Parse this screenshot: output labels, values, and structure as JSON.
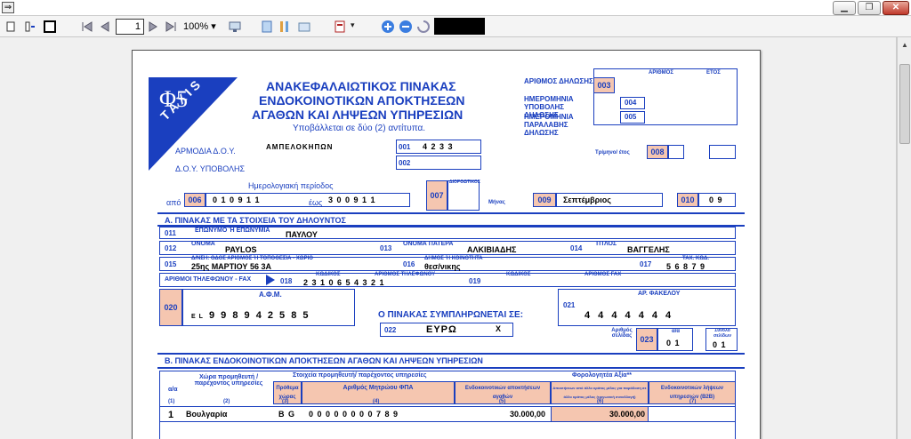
{
  "window": {
    "minimize": "▁",
    "restore": "❐",
    "close": "✕"
  },
  "toolbar": {
    "page": "1",
    "zoom": "100%"
  },
  "colors": {
    "form_blue": "#1a3fbf",
    "code_pink": "#f5c6b0"
  },
  "form": {
    "phi": "Φ5",
    "taxis": "TAXIS",
    "title_1": "ΑΝΑΚΕΦΑΛΑΙΩΤΙΚΟΣ ΠΙΝΑΚΑΣ",
    "title_2": "ΕΝΔΟΚΟΙΝΟΤΙΚΩΝ ΑΠΟΚΤΗΣΕΩΝ",
    "title_3": "ΑΓΑΘΩΝ ΚΑΙ ΛΗΨΕΩΝ ΥΠΗΡΕΣΙΩΝ",
    "subtitle": "Υποβάλλεται σε δύο (2) αντίτυπα.",
    "arithmos_dilosis": "ΑΡΙΘΜΟΣ ΔΗΛΩΣΗΣ",
    "hm_ypovolis": "ΗΜΕΡΟΜΗΝΙΑ ΥΠΟΒΟΛΗΣ ΔΗΛΩΣΗΣ",
    "hm_paralavis": "ΗΜΕΡΟΜΗΝΙΑ ΠΑΡΑΛΑΒΗΣ ΔΗΛΩΣΗΣ",
    "arithmos_col": "ΑΡΙΘΜΟΣ",
    "etos_col": "ΕΤΟΣ",
    "c003": "003",
    "c004": "004",
    "c005": "005",
    "armodia_doy": "ΑΡΜΟΔΙΑ Δ.Ο.Υ.",
    "doy_value": "ΑΜΠΕΛΟΚΗΠΩΝ",
    "doy_ypovolis": "Δ.Ο.Υ. ΥΠΟΒΟΛΗΣ",
    "c001": "001",
    "c001_value": "4 2 3 3",
    "c002": "002",
    "trimino": "Τρίμηνο/ έτος",
    "c008": "008",
    "imerologiaki": "Ημερολογιακή περίοδος",
    "apo": "από",
    "c006": "006",
    "c006_value": "0 1 0 9 1 1",
    "eos": "έως",
    "eos_value": "3 0 0 9 1 1",
    "c007": "007",
    "diorthotiki": "ΔΙΟΡΘΩΤΙΚΟΣ",
    "minas": "Μήνας",
    "c009": "009",
    "c009_value": "Σεπτέμβριος",
    "c010": "010",
    "c010_value": "0 9",
    "section_a": "Α. ΠΙΝΑΚΑΣ ΜΕ ΤΑ ΣΤΟΙΧΕΙΑ ΤΟΥ ΔΗΛΟΥΝΤΟΣ",
    "c011": "011",
    "eponymo_lbl": "ΕΠΩΝΥΜΟ Ή ΕΠΩΝΥΜΙΑ",
    "eponymo": "ΠΑΥΛΟΥ",
    "c012": "012",
    "onoma_lbl": "ΟΝΟΜΑ",
    "onoma": "PAYLOS",
    "c013": "013",
    "onoma_patera_lbl": "ΟΝΟΜΑ ΠΑΤΕΡΑ",
    "onoma_patera": "ΑΛΚΙΒΙΑΔΗΣ",
    "c014": "014",
    "titlos_lbl": "ΤΙΤΛΟΣ",
    "titlos": "ΒΑΓΓΕΛΗΣ",
    "c015": "015",
    "dieuthinsi_lbl": "Δ/ΝΣΗ: ΟΔΟΣ ΑΡΙΘΜΟΣ Ή ΤΟΠΟΘΕΣΙΑ - ΧΩΡΙΟ",
    "dieuthinsi": "25ης ΜΑΡΤΙΟΥ 56 3Α",
    "c016": "016",
    "dimos_lbl": "ΔΗΜΟΣ Ή ΚΟΙΝΟΤΗΤΑ",
    "dimos": "θεσ/νικης",
    "c017": "017",
    "tk_lbl": "ΤΑΧ. ΚΩΔ.",
    "tk": "5 6 8 7 9",
    "tilefono_lbl": "ΑΡΙΘΜΟΙ ΤΗΛΕΦΩΝΟΥ - FAX",
    "c018": "018",
    "kodikos_lbl": "ΚΩΔΙΚΟΣ",
    "ar_til_lbl": "ΑΡΙΘΜΟΣ ΤΗΛΕΦΩΝΟΥ",
    "tilefono": "2 3 1 0 6 5 4 3 2 1",
    "c019": "019",
    "kodikos2_lbl": "ΚΩΔΙΚΟΣ",
    "ar_fax_lbl": "ΑΡΙΘΜΟΣ FAX",
    "c020": "020",
    "afm_lbl": "Α.Φ.Μ.",
    "afm_prefix": "E L",
    "afm": "9 9 8 9 4 2 5 8 5",
    "o_pinakas": "Ο ΠΙΝΑΚΑΣ ΣΥΜΠΛΗΡΩΝΕΤΑΙ ΣΕ:",
    "c022": "022",
    "euro": "ΕΥΡΩ",
    "euro_x": "X",
    "c021": "021",
    "ar_fakelou_lbl": "ΑΡ. ΦΑΚΕΛΟΥ",
    "ar_fakelou": "4 4 4 4 4 4 4",
    "arithmos_selidas": "Αριθμός σελίδας",
    "c023": "023",
    "aa_lbl": "α/α",
    "aa": "0 1",
    "synolo_lbl": "Σύνολο σελίδων",
    "synolo": "0 1",
    "section_b": "Β. ΠΙΝΑΚΑΣ ΕΝΔΟΚΟΙΝΟΤΙΚΩΝ ΑΠΟΚΤΗΣΕΩΝ ΑΓΑΘΩΝ ΚΑΙ ΛΗΨΕΩΝ ΥΠΗΡΕΣΙΩΝ",
    "table": {
      "aa_h": "α/α",
      "aa_n": "(1)",
      "xora_h": "Χώρα προμηθευτή / παρέχοντος υπηρεσίες",
      "xora_n": "(2)",
      "stoixeia_h": "Στοιχεία προμηθευτή/ παρέχοντος υπηρεσίες",
      "prothema_h": "Πρόθεμα χώρας",
      "prothema_n": "(3)",
      "fpa_h": "Αριθμός Μητρώου ΦΠΑ",
      "fpa_n": "(4)",
      "endokoin_h": "Ενδοκοινοτικών αποκτήσεων αγαθών",
      "endokoin_n": "(5)",
      "forologiteа_h": "Φορολογητέα Αξία**",
      "apokt_h": "Αποκτήσεων από άλλο κράτος μέλος για παράδοση σε άλλο κράτος μέλος (τριγωνική συναλλαγή)",
      "apokt_n": "(6)",
      "lipseon_h": "Ενδοκοινοτικών λήψεων υπηρεσιών (Β2Β)",
      "lipseon_n": "(7)",
      "row1": {
        "aa": "1",
        "xora": "Βουλγαρία",
        "prothema": "B G",
        "fpa": "0 0 0 0 0 0 0 0 7 8 9",
        "endokoin": "30.000,00",
        "apokt": "30.000,00"
      }
    }
  }
}
